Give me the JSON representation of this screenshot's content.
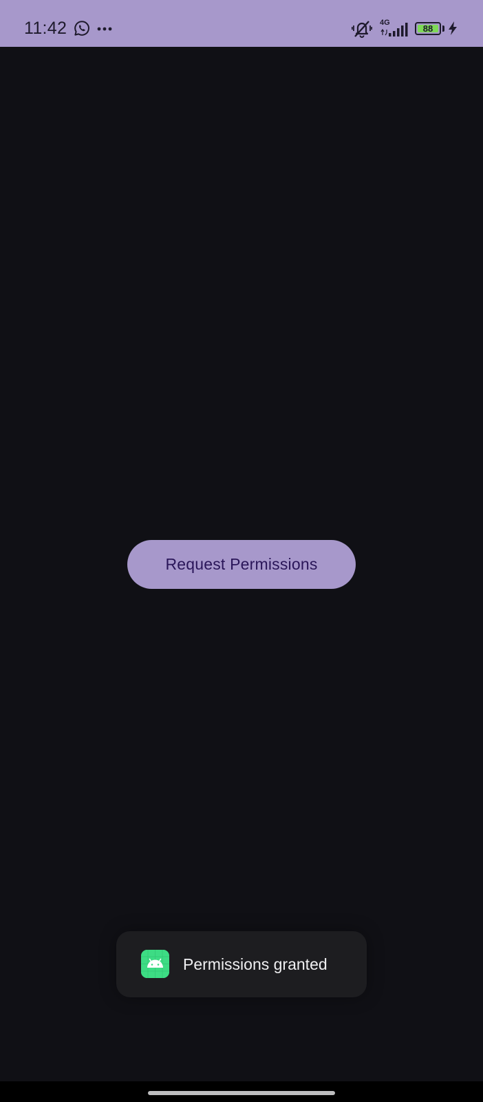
{
  "status_bar": {
    "time": "11:42",
    "network_label": "4G",
    "battery_level": "88",
    "icons": [
      "whatsapp-icon",
      "more-dots-icon",
      "vibrate-mute-icon",
      "signal-icon",
      "battery-icon",
      "charging-bolt-icon"
    ]
  },
  "main": {
    "request_button_label": "Request Permissions"
  },
  "toast": {
    "message": "Permissions granted",
    "app_icon": "android-app-icon"
  },
  "colors": {
    "status_bar_bg": "#a798cb",
    "screen_bg": "#101015",
    "button_bg": "#a798cb",
    "button_text": "#2a1659",
    "toast_bg": "#1d1d20",
    "battery_fill": "#7ed957",
    "android_green": "#3ddc84"
  }
}
